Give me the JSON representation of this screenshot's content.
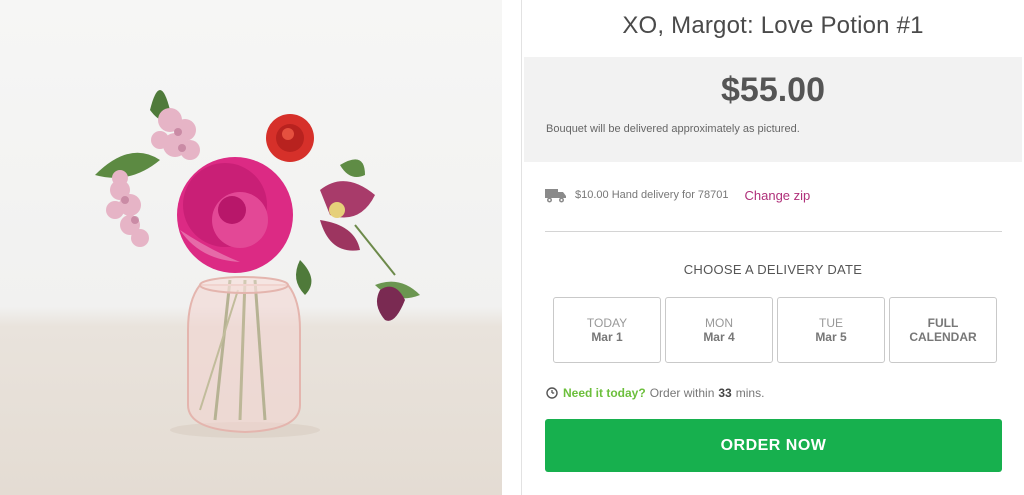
{
  "product": {
    "title": "XO, Margot: Love Potion #1",
    "price": "$55.00",
    "price_note": "Bouquet will be delivered approximately as pictured."
  },
  "delivery": {
    "icon": "truck-icon",
    "text": "$10.00 Hand delivery for 78701",
    "change_zip_label": "Change zip"
  },
  "date_picker": {
    "heading": "CHOOSE A DELIVERY DATE",
    "options": [
      {
        "day": "TODAY",
        "date": "Mar 1"
      },
      {
        "day": "MON",
        "date": "Mar 4"
      },
      {
        "day": "TUE",
        "date": "Mar 5"
      },
      {
        "day": "FULL",
        "date": "CALENDAR"
      }
    ]
  },
  "urgency": {
    "icon": "clock-icon",
    "highlight": "Need it today?",
    "prefix": "Order within",
    "minutes": "33",
    "suffix": "mins."
  },
  "order_button_label": "ORDER NOW",
  "colors": {
    "accent_green": "#17b04e",
    "link_magenta": "#b0307a",
    "urgency_green": "#6cbf3c"
  }
}
